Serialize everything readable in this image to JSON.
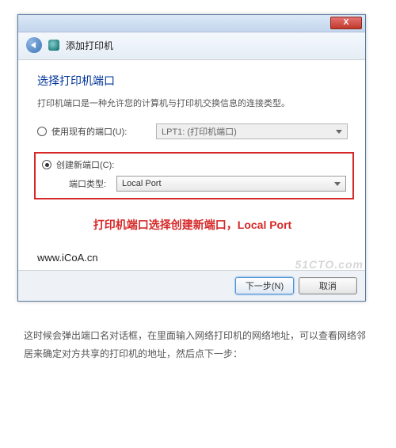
{
  "window": {
    "close_glyph": "X",
    "wizard_title": "添加打印机"
  },
  "content": {
    "heading": "选择打印机端口",
    "description": "打印机端口是一种允许您的计算机与打印机交换信息的连接类型。",
    "option_existing": {
      "label": "使用现有的端口(U):",
      "combo_value": "LPT1: (打印机端口)"
    },
    "option_create": {
      "label": "创建新端口(C):",
      "port_type_label": "端口类型:",
      "port_type_value": "Local Port"
    },
    "annotation": "打印机端口选择创建新端口，Local Port",
    "url": "www.iCoA.cn"
  },
  "footer": {
    "watermark": "51CTO.com",
    "next": "下一步(N)",
    "cancel": "取消"
  },
  "article": {
    "p1": "这时候会弹出端口名对话框，在里面输入网络打印机的网络地址，可以查看网络邻居来确定对方共享的打印机的地址，然后点下一步："
  }
}
